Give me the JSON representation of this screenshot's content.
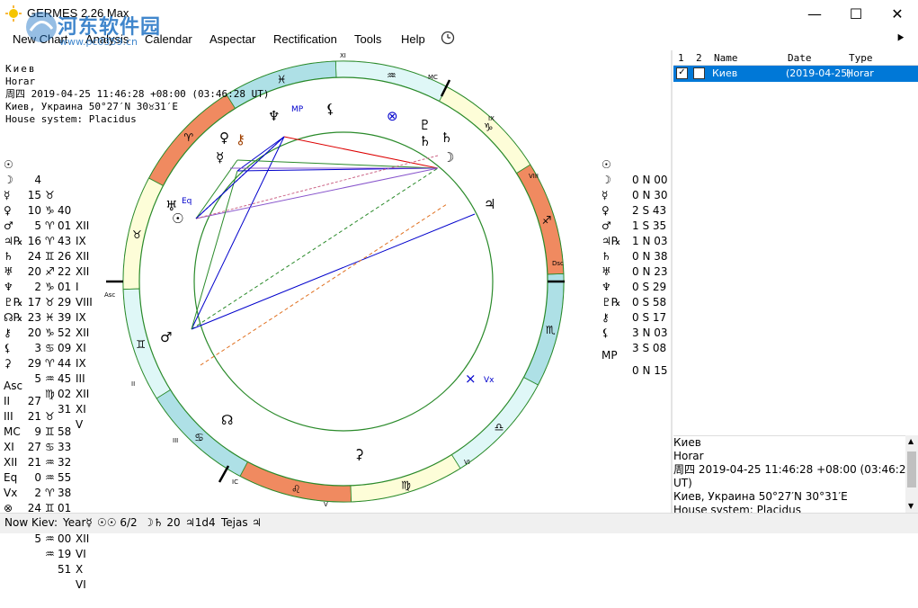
{
  "window": {
    "title": "GERMES 2.26 Max",
    "watermark_main": "河东软件园",
    "watermark_url": "www.pc0359.cn"
  },
  "menu": [
    "New Chart",
    "Analysis",
    "Calendar",
    "Aspectar",
    "Rectification",
    "Tools",
    "Help"
  ],
  "header": {
    "name": "Киев",
    "type": "Horar",
    "datetime": "周四 2019-04-25 11:46:28 +08:00 (03:46:28 UT)",
    "place": "Киев, Украина 50°27′N 30♉31′E",
    "house_system": "House system: Placidus"
  },
  "planets": [
    {
      "glyph": "☉",
      "deg": "4",
      "sign": "♉",
      "min": "40",
      "house": "XII"
    },
    {
      "glyph": "☽",
      "deg": "15",
      "sign": "♑",
      "min": "01",
      "house": "IX"
    },
    {
      "glyph": "☿",
      "deg": "10",
      "sign": "♈",
      "min": "43",
      "house": "XII"
    },
    {
      "glyph": "♀",
      "deg": "5",
      "sign": "♈",
      "min": "26",
      "house": "XII"
    },
    {
      "glyph": "♂",
      "deg": "16",
      "sign": "♊",
      "min": "22",
      "house": "I"
    },
    {
      "glyph": "♃℞",
      "deg": "24",
      "sign": "♐",
      "min": "01",
      "house": "VIII"
    },
    {
      "glyph": "♄",
      "deg": "20",
      "sign": "♑",
      "min": "29",
      "house": "IX"
    },
    {
      "glyph": "♅",
      "deg": "2",
      "sign": "♉",
      "min": "39",
      "house": "XII"
    },
    {
      "glyph": "♆",
      "deg": "17",
      "sign": "♓",
      "min": "52",
      "house": "XI"
    },
    {
      "glyph": "♇℞",
      "deg": "23",
      "sign": "♑",
      "min": "09",
      "house": "IX"
    },
    {
      "glyph": "☊℞",
      "deg": "20",
      "sign": "♋",
      "min": "44",
      "house": "III"
    },
    {
      "glyph": "⚷",
      "deg": "3",
      "sign": "♈",
      "min": "45",
      "house": "XII"
    },
    {
      "glyph": "⚸",
      "deg": "29",
      "sign": "♒",
      "min": "02",
      "house": "XI"
    },
    {
      "glyph": "⚳",
      "deg": "5",
      "sign": "♍",
      "min": "31",
      "house": "V"
    }
  ],
  "cusps": [
    {
      "label": "Asc",
      "deg": "27",
      "sign": "♉",
      "min": "58"
    },
    {
      "label": "II",
      "deg": "21",
      "sign": "♊",
      "min": "33"
    },
    {
      "label": "III",
      "deg": "9",
      "sign": "♋",
      "min": "32"
    },
    {
      "label": "MC",
      "deg": "27",
      "sign": "♒",
      "min": "55"
    },
    {
      "label": "XI",
      "deg": "21",
      "sign": "♒",
      "min": "38"
    },
    {
      "label": "XII",
      "deg": "0",
      "sign": "♈",
      "min": "01"
    },
    {
      "label": "Eq",
      "deg": "2",
      "sign": "♊",
      "min": "11",
      "house": "XII"
    },
    {
      "label": "Vx",
      "deg": "24",
      "sign": "♒",
      "min": "00",
      "house": "VI"
    },
    {
      "label": "⊗",
      "deg": "8",
      "sign": "♒",
      "min": "19",
      "house": "X"
    },
    {
      "label": "x",
      "deg": "5",
      "sign": "♒",
      "min": "51",
      "house": "VI"
    }
  ],
  "declinations": [
    {
      "glyph": "☉",
      "v": "0 N 00"
    },
    {
      "glyph": "☽",
      "v": "0 N 30"
    },
    {
      "glyph": "☿",
      "v": "2 S 43"
    },
    {
      "glyph": "♀",
      "v": "1 S 35"
    },
    {
      "glyph": "♂",
      "v": "1 N 03"
    },
    {
      "glyph": "♃℞",
      "v": "0 N 38"
    },
    {
      "glyph": "♄",
      "v": "0 N 23"
    },
    {
      "glyph": "♅",
      "v": "0 S 29"
    },
    {
      "glyph": "♆",
      "v": "0 S 58"
    },
    {
      "glyph": "♇℞",
      "v": "0 S 17"
    },
    {
      "glyph": "⚷",
      "v": "3 N 03"
    },
    {
      "glyph": "⚸",
      "v": "3 S 08"
    },
    {
      "glyph": "MP",
      "v": "0 N 15"
    }
  ],
  "chart_labels": {
    "asc": "Asc",
    "dsc": "Dsc",
    "mc": "MC",
    "ic": "IC",
    "vx": "Vx",
    "eq": "Eq",
    "mp": "MP",
    "houses": [
      "XI",
      "IX",
      "VIII",
      "VI",
      "V",
      "IV",
      "III",
      "II"
    ]
  },
  "table": {
    "headers": [
      "1",
      "2",
      "Name",
      "Date",
      "Type"
    ],
    "rows": [
      {
        "name": "Киев",
        "date": "(2019-04-25)",
        "type": "Horar"
      }
    ]
  },
  "detail": {
    "name": "Киев",
    "type": "Horar",
    "datetime": "周四 2019-04-25 11:46:28 +08:00 (03:46:28",
    "datetime2": "UT)",
    "place": "Киев, Украина 50°27′N 30°31′E",
    "house_system": "House system: Placidus"
  },
  "status": {
    "now": "Now Kiev:",
    "year": "Year☿",
    "a1": "☉☉ 6/2",
    "a2": "☽♄ 20",
    "a3": "♃1d4",
    "a4": "Tejas",
    "a5": "♃"
  }
}
